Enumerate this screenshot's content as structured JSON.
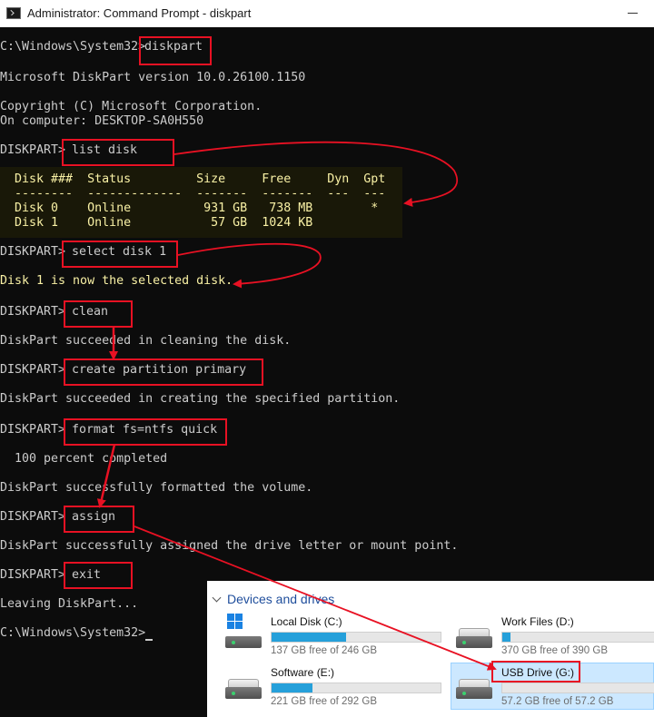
{
  "window": {
    "title": "Administrator: Command Prompt - diskpart",
    "icon": "cmd-icon"
  },
  "console": {
    "prompt_path": "C:\\Windows\\System32>",
    "cmd_diskpart": "diskpart",
    "version_line": "Microsoft DiskPart version 10.0.26100.1150",
    "copyright_line": "Copyright (C) Microsoft Corporation.",
    "computer_line": "On computer: DESKTOP-SA0H550",
    "dp_prompt": "DISKPART>",
    "cmd_list_disk": "list disk",
    "disk_table": {
      "header": "  Disk ###  Status         Size     Free     Dyn  Gpt",
      "divider": "  --------  -------------  -------  -------  ---  ---",
      "row0": "  Disk 0    Online          931 GB   738 MB        *",
      "row1": "  Disk 1    Online           57 GB  1024 KB"
    },
    "cmd_select_disk": "select disk 1",
    "select_result": "Disk 1 is now the selected disk.",
    "cmd_clean": "clean",
    "clean_result": "DiskPart succeeded in cleaning the disk.",
    "cmd_create": "create partition primary",
    "create_result": "DiskPart succeeded in creating the specified partition.",
    "cmd_format": "format fs=ntfs quick",
    "format_progress": "  100 percent completed",
    "format_result": "DiskPart successfully formatted the volume.",
    "cmd_assign": "assign",
    "assign_result": "DiskPart successfully assigned the drive letter or mount point.",
    "cmd_exit": "exit",
    "exit_result": "Leaving DiskPart...",
    "final_prompt": "C:\\Windows\\System32>"
  },
  "explorer": {
    "section_title": "Devices and drives",
    "drives": [
      {
        "name": "Local Disk (C:)",
        "info": "137 GB free of 246 GB",
        "used_fraction": 0.443,
        "icon": "windows-drive-icon"
      },
      {
        "name": "Work Files (D:)",
        "info": "370 GB free of 390 GB",
        "used_fraction": 0.051,
        "icon": "hard-drive-icon"
      },
      {
        "name": "Software (E:)",
        "info": "221 GB free of 292 GB",
        "used_fraction": 0.243,
        "icon": "hard-drive-icon"
      },
      {
        "name": "USB Drive (G:)",
        "info": "57.2 GB free of 57.2 GB",
        "used_fraction": 0.0,
        "icon": "usb-drive-icon"
      }
    ]
  },
  "colors": {
    "console_bg": "#0c0c0c",
    "console_text": "#cccccc",
    "yellow_text": "#f9f1a5",
    "highlight_red": "#e81123",
    "progress_blue": "#26a0da",
    "selection_bg": "#cce8ff"
  }
}
